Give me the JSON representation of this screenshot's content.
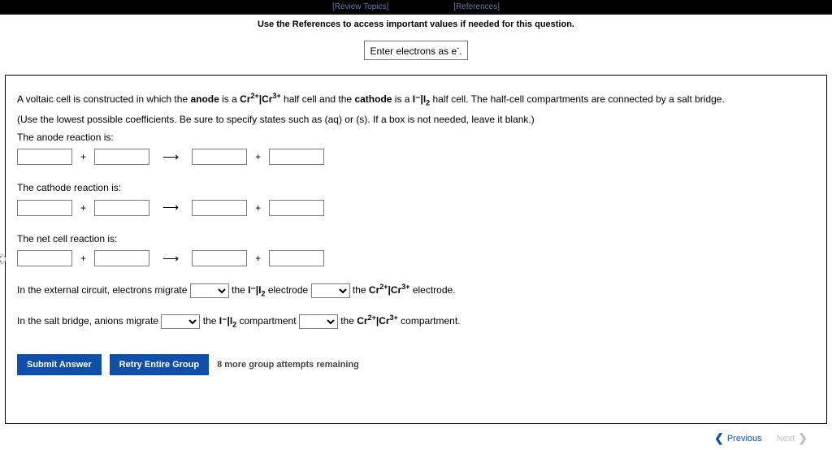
{
  "topbar": {
    "review_topics": "[Review Topics]",
    "references": "[References]"
  },
  "instruction": "Use the References to access important values if needed for this question.",
  "hint": {
    "prefix": "Enter electrons as e",
    "suffix": "."
  },
  "problem": {
    "p1_a": "A voltaic cell is constructed in which the ",
    "p1_anode": "anode",
    "p1_b": " is a ",
    "p1_c": " half cell and the ",
    "p1_cathode": "cathode",
    "p1_d": " is a ",
    "p1_e": " half cell. The half-cell compartments are connected by a salt bridge.",
    "p2": "(Use the lowest possible coefficients. Be sure to specify states such as (aq) or (s). If a box is not needed, leave it blank.)"
  },
  "sections": {
    "anode_label": "The anode reaction is:",
    "cathode_label": "The cathode reaction is:",
    "net_label": "The net cell reaction is:"
  },
  "migrate": {
    "q1_a": "In the external circuit, electrons migrate ",
    "q1_b": " the ",
    "q1_c": " electrode ",
    "q1_d": " the ",
    "q1_e": " electrode.",
    "q2_a": "In the salt bridge, anions migrate ",
    "q2_b": " the ",
    "q2_c": " compartment ",
    "q2_d": " the ",
    "q2_e": " compartment."
  },
  "cell_labels": {
    "i_i2_html": "I⁻|I",
    "cr_html": "Cr"
  },
  "buttons": {
    "submit": "Submit Answer",
    "retry": "Retry Entire Group"
  },
  "attempts": "8 more group attempts remaining",
  "nav": {
    "previous": "Previous",
    "next": "Next"
  }
}
